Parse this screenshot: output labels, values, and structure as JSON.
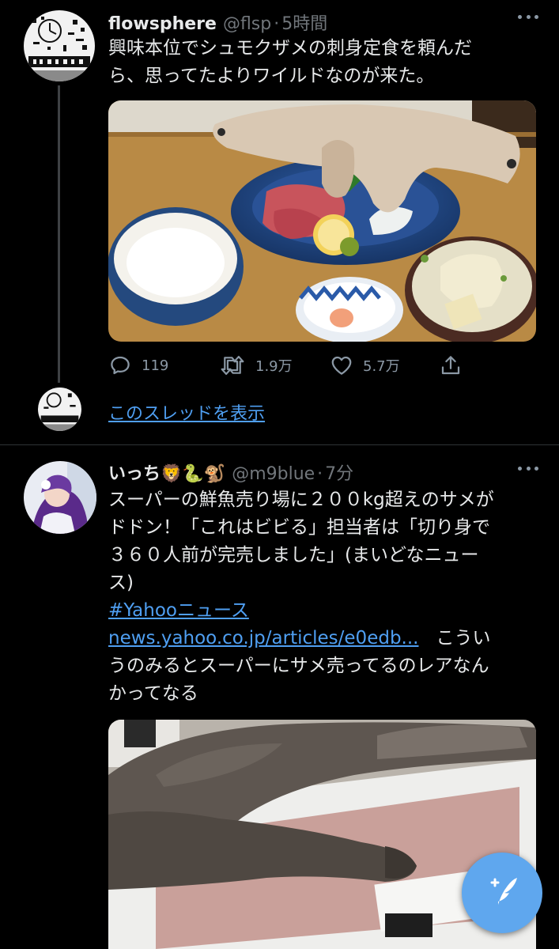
{
  "tweet1": {
    "display_name": "flowsphere",
    "handle": "@flsp",
    "dot": "·",
    "time": "5時間",
    "text_line1": "興味本位でシュモクザメの刺身定食を頼んだ",
    "text_line2": "ら、思ってたよりワイルドなのが来た。",
    "actions": {
      "reply_count": "119",
      "retweet_count": "1.9万",
      "like_count": "5.7万"
    },
    "show_thread_label": "このスレッドを表示"
  },
  "tweet2": {
    "display_name": "いっち🦁🐍🐒",
    "handle": "@m9blue",
    "dot": "·",
    "time": "7分",
    "text_line1": "スーパーの鮮魚売り場に２００kg超えのサメが",
    "text_line2": "ドドン！「これはビビる」担当者は「切り身で",
    "text_line3": "３６０人前が完売しました」(まいどなニュー",
    "text_line4": "ス)",
    "hashtag": "#Yahooニュース",
    "url": "news.yahoo.co.jp/articles/e0edb...",
    "comment_part1": "こうい",
    "comment_line2": "うのみるとスーパーにサメ売ってるのレアなん",
    "comment_line3": "かってなる"
  },
  "colors": {
    "background": "#000000",
    "text": "#e7e9ea",
    "secondary": "#71767b",
    "link": "#4f9ff2",
    "fab": "#5fa7ee"
  },
  "icons": {
    "more": "ellipsis-icon",
    "reply": "reply-bubble-icon",
    "retweet": "retweet-icon",
    "like": "heart-icon",
    "share": "share-icon",
    "compose": "compose-feather-icon"
  }
}
